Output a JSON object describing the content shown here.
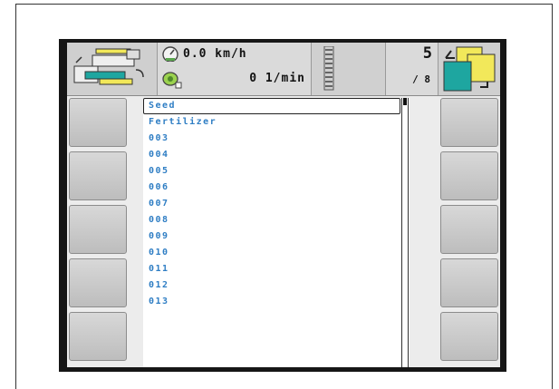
{
  "header": {
    "speed_value": "0.0 km/h",
    "rpm_value": "0 1/min",
    "page_current": "5",
    "page_total": "/ 8",
    "icons": [
      "machine-config-icon",
      "speedometer-icon",
      "rpm-sensor-icon",
      "tire-track-icon",
      "mode-switch-icon"
    ]
  },
  "list": {
    "items": [
      "Seed",
      "Fertilizer",
      "003",
      "004",
      "005",
      "006",
      "007",
      "008",
      "009",
      "010",
      "011",
      "012",
      "013"
    ],
    "selected_index": 0,
    "text_color": "#2f7ec4"
  },
  "softkeys": {
    "left_count": 5,
    "right_count": 5
  },
  "colors": {
    "accent_yellow": "#f2e85a",
    "accent_teal": "#1ea6a0"
  }
}
